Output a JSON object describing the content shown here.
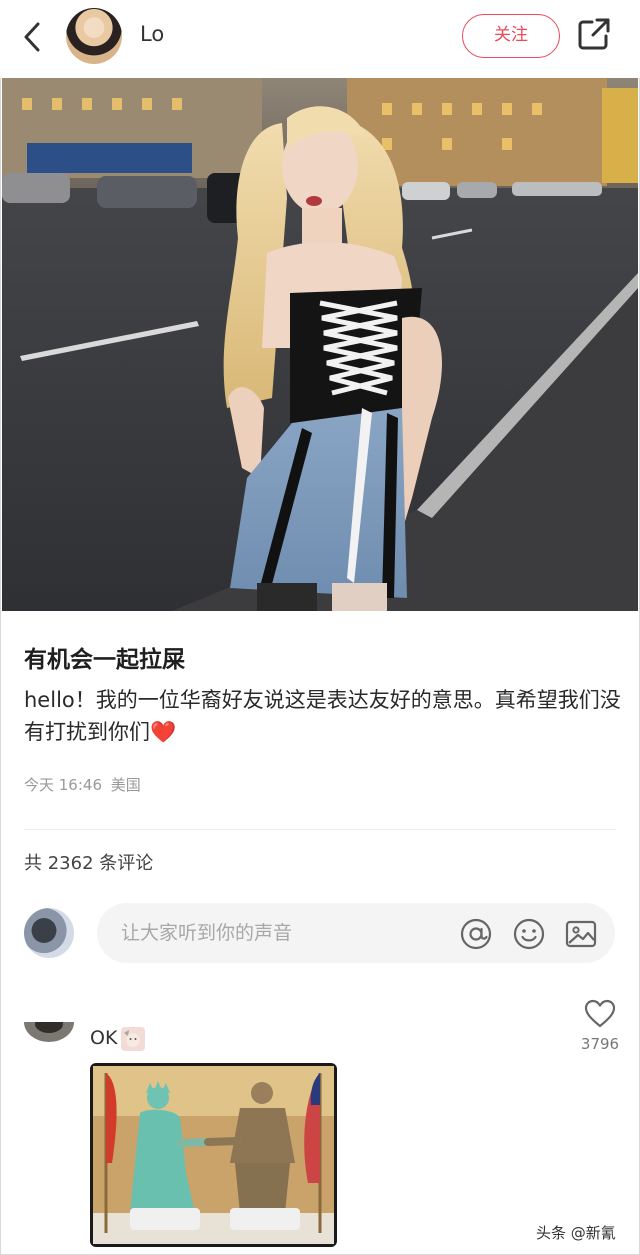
{
  "header": {
    "author_name": "Lo",
    "follow_label": "关注"
  },
  "post": {
    "title": "有机会一起拉屎",
    "body": "hello！我的一位华裔好友说这是表达友好的意思。真希望我们没有打扰到你们❤️",
    "time": "今天 16:46",
    "location": "美国"
  },
  "comments": {
    "count_label": "共 2362 条评论",
    "input_placeholder": "让大家听到你的声音",
    "items": [
      {
        "text": "OK",
        "likes": "3796"
      }
    ]
  },
  "icons": {
    "back": "back-arrow-icon",
    "share": "share-icon",
    "mention": "at-icon",
    "emoji": "emoji-icon",
    "image": "image-icon",
    "like": "heart-icon"
  },
  "colors": {
    "accent": "#e94a5c",
    "heart": "#e94a5c"
  },
  "watermark": "头条 @新氰"
}
